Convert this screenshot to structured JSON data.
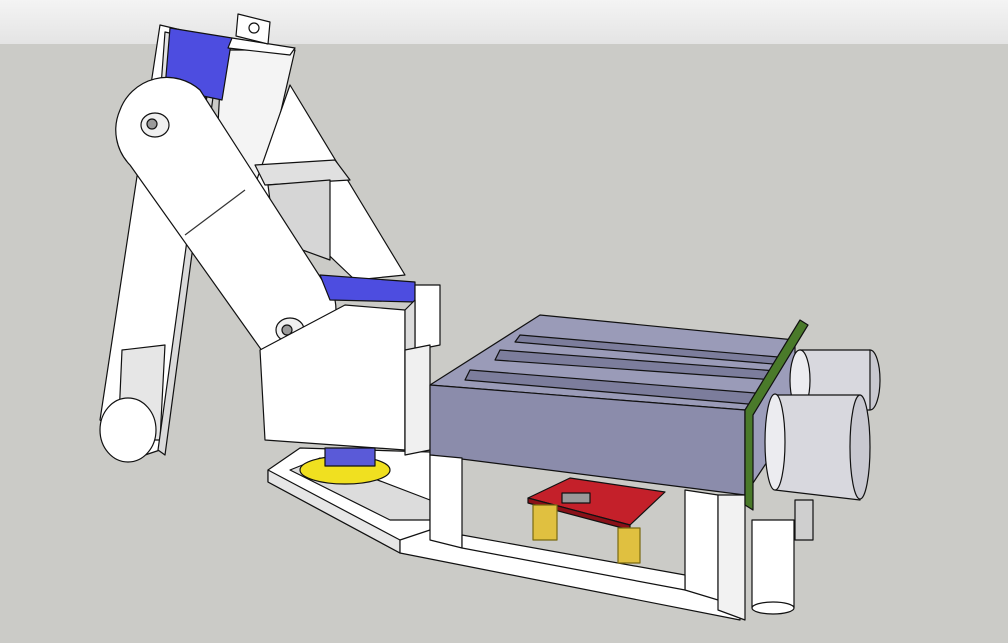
{
  "viewport": {
    "sky_color": "#eeeeee",
    "ground_color": "#cbcbc7"
  },
  "model": {
    "colors": {
      "body": "#ffffff",
      "shade": "#e2e2e2",
      "servo_blue": "#4d4de0",
      "tray": "#8b8cab",
      "yellow_disc": "#f0e020",
      "pcb_red": "#c4202a",
      "sensor_pcb": "#4a7a2a",
      "sensor_can": "#d8d8de",
      "pins": "#e0c040"
    }
  }
}
